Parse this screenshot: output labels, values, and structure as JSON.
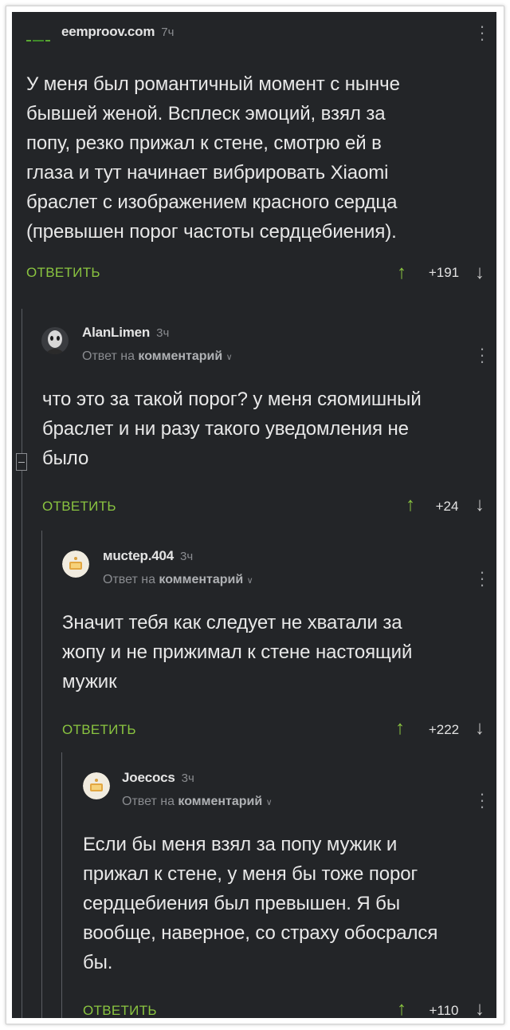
{
  "colors": {
    "background": "#232528",
    "text": "#e8e8e8",
    "accent_green": "#8ac440",
    "muted": "#8a8c90"
  },
  "comments": [
    {
      "author": "eemproov.com",
      "time": "7ч",
      "text_lines": [
        "У меня был романтичный момент с нынче",
        "бывшей женой. Всплеск эмоций, взял за",
        "попу, резко прижал к стене, смотрю ей в",
        "глаза и тут начинает вибрировать Xiaomi",
        "браслет с изображением красного сердца",
        "(превышен порог частоты сердцебиения)."
      ],
      "reply_label": "ОТВЕТИТЬ",
      "rating": "+191",
      "avatar_icon": "site-logo-icon"
    },
    {
      "author": "AlanLimen",
      "time": "3ч",
      "reply_prefix": "Ответ на",
      "reply_target": "комментарий",
      "text_lines": [
        "что это за такой порог? у меня сяомишный",
        "браслет и ни разу такого уведомления не",
        "было"
      ],
      "reply_label": "ОТВЕТИТЬ",
      "rating": "+24",
      "avatar_icon": "user-avatar-icon"
    },
    {
      "author": "мuctep.404",
      "time": "3ч",
      "reply_prefix": "Ответ на",
      "reply_target": "комментарий",
      "text_lines": [
        "Значит тебя как следует не хватали за",
        "жопу и не прижимал к стене настоящий",
        "мужик"
      ],
      "reply_label": "ОТВЕТИТЬ",
      "rating": "+222",
      "avatar_icon": "default-avatar-icon"
    },
    {
      "author": "Joecocs",
      "time": "3ч",
      "reply_prefix": "Ответ на",
      "reply_target": "комментарий",
      "text_lines": [
        "Если бы меня взял за попу мужик и",
        "прижал к стене, у меня бы тоже порог",
        "сердцебиения был превышен. Я бы",
        "вообще, наверное, со страху обосрался",
        "бы."
      ],
      "reply_label": "ОТВЕТИТЬ",
      "rating": "+110",
      "avatar_icon": "default-avatar-icon"
    }
  ]
}
